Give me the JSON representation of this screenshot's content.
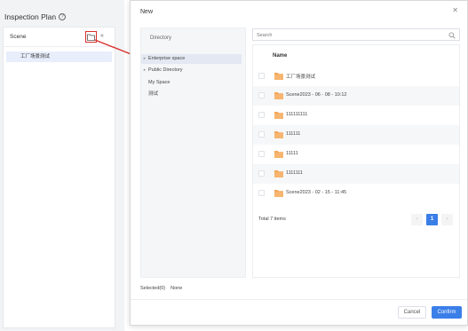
{
  "background": {
    "title": "Inspection Plan",
    "scene_label": "Scene",
    "list_item": "工厂场景测试",
    "accent": "#d9302b"
  },
  "modal": {
    "title": "New",
    "directory": {
      "title": "Directory",
      "items": [
        {
          "label": "Enterprise space",
          "expandable": true
        },
        {
          "label": "Public Directory",
          "expandable": true
        },
        {
          "label": "My Space",
          "expandable": false
        },
        {
          "label": "测试",
          "expandable": false
        }
      ]
    },
    "selected": {
      "label": "Selected(0)",
      "value": "None"
    },
    "search": {
      "placeholder": "Search"
    },
    "table": {
      "header": "Name",
      "rows": [
        "工厂场景测试",
        "Scene2023 - 06 - 08 - 10:12",
        "111111111",
        "111111",
        "11111",
        "1111111",
        "Scene2023 - 02 - 15 - 11:45"
      ],
      "total": "Total 7 items"
    },
    "pagination": {
      "prev": "‹",
      "current": "1",
      "next": "›"
    },
    "buttons": {
      "cancel": "Cancel",
      "confirm": "Confirm"
    },
    "colors": {
      "primary": "#3a7ee8",
      "folder": "#f3a65b"
    }
  }
}
